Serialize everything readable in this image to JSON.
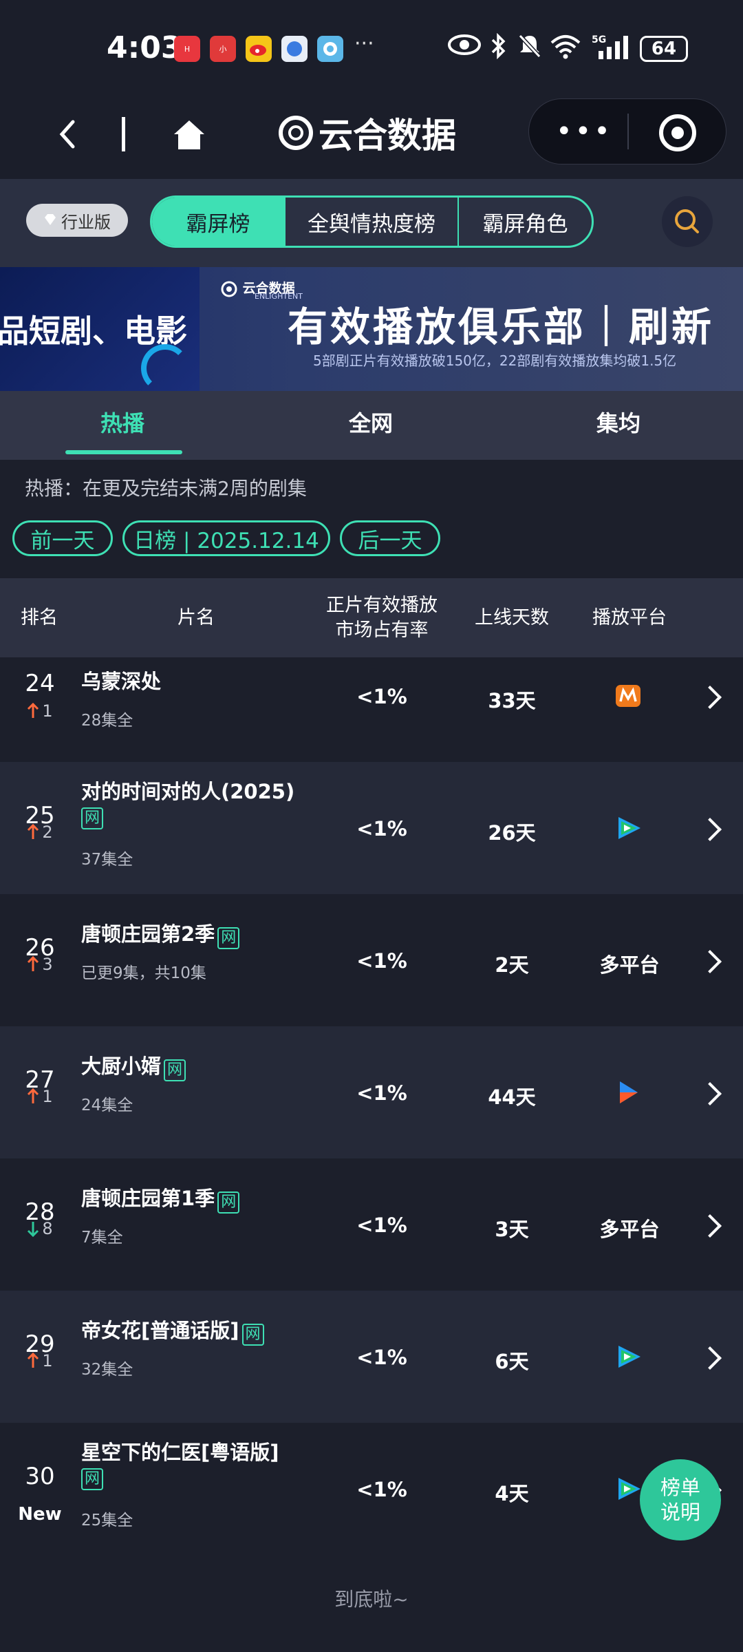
{
  "status_bar": {
    "time": "4:03",
    "battery": "64",
    "network": "5G"
  },
  "nav": {
    "app_title": "云合数据"
  },
  "filter_bar": {
    "badge": "行业版",
    "segments": [
      "霸屏榜",
      "全舆情热度榜",
      "霸屏角色"
    ],
    "active_segment": "霸屏榜"
  },
  "banner": {
    "left_text": "品短剧、电影",
    "logo_text": "云合数据",
    "logo_sub": "ENLIGHTENT",
    "main_text": "有效播放俱乐部｜刷新",
    "sub_text": "5部剧正片有效播放破150亿，22部剧有效播放集均破1.5亿"
  },
  "tabs": {
    "items": [
      "热播",
      "全网",
      "集均"
    ],
    "active": "热播"
  },
  "description": "热播：在更及完结未满2周的剧集",
  "date_nav": {
    "prev": "前一天",
    "current": "日榜 | 2025.12.14",
    "next": "后一天"
  },
  "table": {
    "headers": {
      "rank": "排名",
      "title": "片名",
      "share_line1": "正片有效播放",
      "share_line2": "市场占有率",
      "days": "上线天数",
      "platform": "播放平台"
    },
    "rows": [
      {
        "rank": "24",
        "change_dir": "up",
        "change": "1",
        "title": "乌蒙深处",
        "net_badge": "",
        "title_line2": "",
        "episodes": "28集全",
        "share": "<1%",
        "days": "33天",
        "platform": "mango-tv-icon",
        "platform_text": ""
      },
      {
        "rank": "25",
        "change_dir": "up",
        "change": "2",
        "title": "对的时间对的人(2025)",
        "net_badge": "",
        "title_line2": "网",
        "episodes": "37集全",
        "share": "<1%",
        "days": "26天",
        "platform": "tencent-video-icon",
        "platform_text": ""
      },
      {
        "rank": "26",
        "change_dir": "up",
        "change": "3",
        "title": "唐顿庄园第2季",
        "net_badge": "网",
        "title_line2": "",
        "episodes": "已更9集，共10集",
        "share": "<1%",
        "days": "2天",
        "platform": "",
        "platform_text": "多平台"
      },
      {
        "rank": "27",
        "change_dir": "up",
        "change": "1",
        "title": "大厨小婿",
        "net_badge": "网",
        "title_line2": "",
        "episodes": "24集全",
        "share": "<1%",
        "days": "44天",
        "platform": "youku-icon",
        "platform_text": ""
      },
      {
        "rank": "28",
        "change_dir": "down",
        "change": "8",
        "title": "唐顿庄园第1季",
        "net_badge": "网",
        "title_line2": "",
        "episodes": "7集全",
        "share": "<1%",
        "days": "3天",
        "platform": "",
        "platform_text": "多平台"
      },
      {
        "rank": "29",
        "change_dir": "up",
        "change": "1",
        "title": "帝女花[普通话版]",
        "net_badge": "网",
        "title_line2": "",
        "episodes": "32集全",
        "share": "<1%",
        "days": "6天",
        "platform": "tencent-video-icon",
        "platform_text": ""
      },
      {
        "rank": "30",
        "change_dir": "new",
        "change": "New",
        "title": "星空下的仁医[粤语版]",
        "net_badge": "",
        "title_line2": "网",
        "episodes": "25集全",
        "share": "<1%",
        "days": "4天",
        "platform": "tencent-video-icon",
        "platform_text": ""
      }
    ]
  },
  "footer": "到底啦~",
  "fab": {
    "line1": "榜单",
    "line2": "说明"
  },
  "colors": {
    "accent": "#3ee0b4",
    "up": "#ff6a3d",
    "down": "#2ec79a",
    "background": "#1c1f2b"
  }
}
